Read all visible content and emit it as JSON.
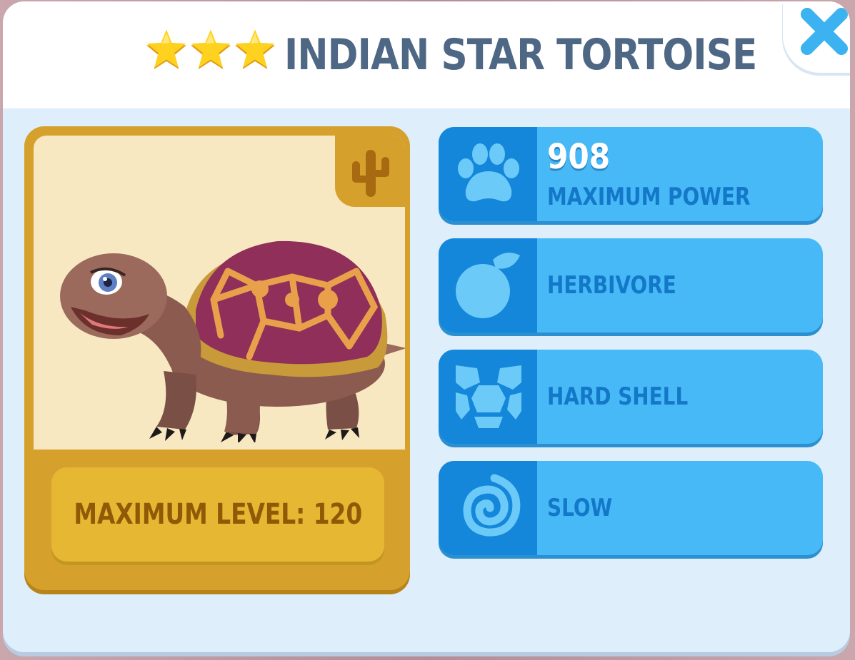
{
  "dialog": {
    "title": "INDIAN STAR TORTOISE",
    "star_rating": 3,
    "close_icon": "close-x-icon"
  },
  "animal_card": {
    "biome_icon": "cactus-icon",
    "max_level_text": "MAXIMUM LEVEL: 120"
  },
  "traits": [
    {
      "icon": "paw-icon",
      "value": "908",
      "label": "MAXIMUM POWER"
    },
    {
      "icon": "fruit-icon",
      "label": "HERBIVORE"
    },
    {
      "icon": "shell-icon",
      "label": "HARD SHELL"
    },
    {
      "icon": "spiral-icon",
      "label": "SLOW"
    }
  ],
  "colors": {
    "title": "#4d6784",
    "close": "#3cb2f0",
    "card_gold": "#d6a02c",
    "trait_bg": "#48b9f7",
    "trait_icon_bg": "#1487da",
    "trait_text": "#1478c9"
  }
}
